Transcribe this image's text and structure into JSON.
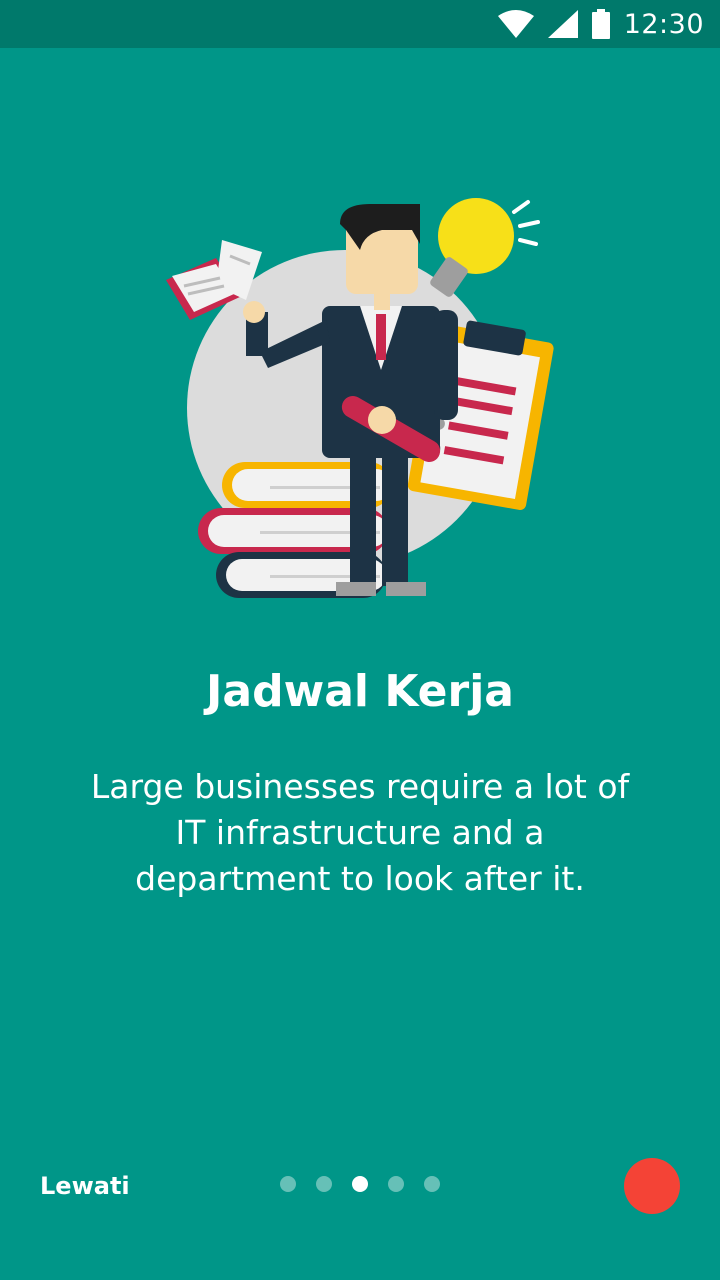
{
  "status_bar": {
    "time": "12:30",
    "icons": [
      "wifi-icon",
      "signal-icon",
      "battery-icon"
    ]
  },
  "onboarding": {
    "illustration": "businessman-with-books-bulb-clipboard",
    "title": "Jadwal Kerja",
    "description": "Large businesses require a lot of IT infrastructure and a department to look after it."
  },
  "footer": {
    "skip_label": "Lewati",
    "page_count": 5,
    "active_page": 3,
    "next_button": "next-button-icon"
  },
  "colors": {
    "background": "#009688",
    "status_bar": "#00796b",
    "next_button": "#f44336"
  }
}
